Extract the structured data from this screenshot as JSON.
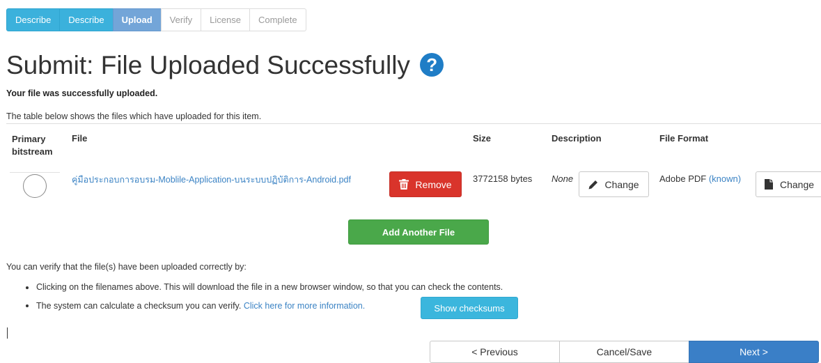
{
  "steps": [
    {
      "label": "Describe",
      "state": "done"
    },
    {
      "label": "Describe",
      "state": "done"
    },
    {
      "label": "Upload",
      "state": "active"
    },
    {
      "label": "Verify",
      "state": "pending"
    },
    {
      "label": "License",
      "state": "pending"
    },
    {
      "label": "Complete",
      "state": "pending"
    }
  ],
  "page": {
    "title": "Submit: File Uploaded Successfully",
    "help_icon_glyph": "?",
    "success_message": "Your file was successfully uploaded.",
    "intro": "The table below shows the files which have uploaded for this item."
  },
  "table": {
    "headers": {
      "primary_line1": "Primary",
      "primary_line2": "bitstream",
      "file": "File",
      "size": "Size",
      "description": "Description",
      "format": "File Format"
    },
    "row": {
      "file_name": "คู่มือประกอบการอบรม-Moblile-Application-บนระบบปฏิบัติการ-Android.pdf",
      "remove_label": "Remove",
      "size": "3772158 bytes",
      "description": "None",
      "change_label": "Change",
      "format": "Adobe PDF",
      "format_status": "(known)",
      "format_change_label": "Change"
    }
  },
  "add_file_label": "Add Another File",
  "verify": {
    "intro": "You can verify that the file(s) have been uploaded correctly by:",
    "bullet1": "Clicking on the filenames above. This will download the file in a new browser window, so that you can check the contents.",
    "bullet2_text": "The system can calculate a checksum you can verify.",
    "bullet2_link": "Click here for more information.",
    "checksum_button": "Show checksums"
  },
  "nav": {
    "previous": "< Previous",
    "cancel_save": "Cancel/Save",
    "next": "Next >"
  },
  "icons": {
    "trash": "trash-icon",
    "pencil": "pencil-icon",
    "file": "file-icon",
    "help": "question-circle-icon"
  },
  "colors": {
    "step_done": "#3bb1dc",
    "step_active": "#73a5d8",
    "danger": "#d9342b",
    "success": "#4aa84a",
    "info": "#3bb6dd",
    "primary": "#3a7fc7",
    "link": "#3b83c4"
  }
}
